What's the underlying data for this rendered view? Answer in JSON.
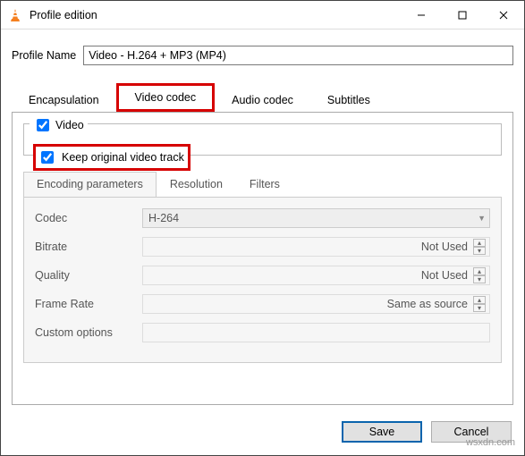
{
  "window": {
    "title": "Profile edition"
  },
  "profile": {
    "label": "Profile Name",
    "value": "Video - H.264 + MP3 (MP4)"
  },
  "tabs": {
    "encapsulation": "Encapsulation",
    "video_codec": "Video codec",
    "audio_codec": "Audio codec",
    "subtitles": "Subtitles"
  },
  "video": {
    "checkbox_label": "Video",
    "keep_original": "Keep original video track"
  },
  "subtabs": {
    "encoding": "Encoding parameters",
    "resolution": "Resolution",
    "filters": "Filters"
  },
  "encoding": {
    "codec_label": "Codec",
    "codec_value": "H-264",
    "bitrate_label": "Bitrate",
    "bitrate_value": "Not Used",
    "quality_label": "Quality",
    "quality_value": "Not Used",
    "framerate_label": "Frame Rate",
    "framerate_value": "Same as source",
    "custom_label": "Custom options"
  },
  "buttons": {
    "save": "Save",
    "cancel": "Cancel"
  },
  "watermark": "wsxdn.com"
}
